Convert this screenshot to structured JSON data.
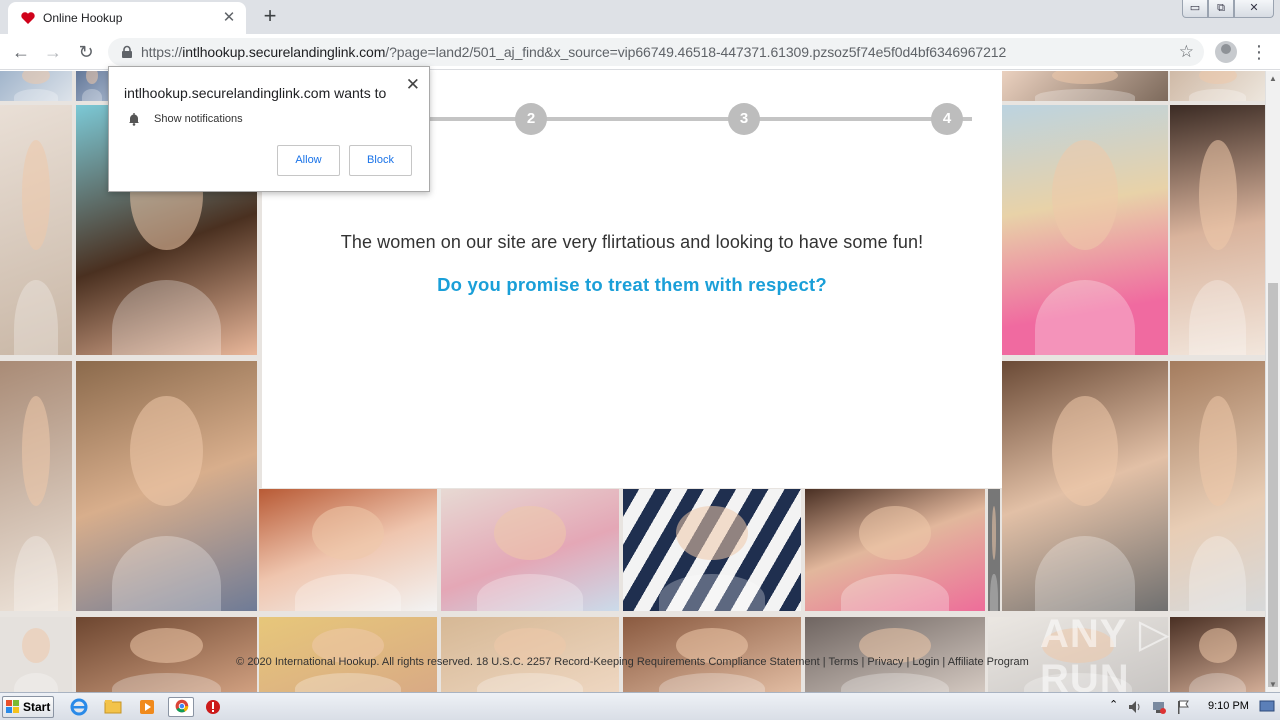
{
  "browser": {
    "tab_title": "Online Hookup",
    "tab_close": "✕",
    "new_tab": "+",
    "window_min": "▭",
    "window_max": "⧉",
    "window_close": "✕",
    "url_host": "intlhookup.securelandinglink.com",
    "url_scheme": "https://",
    "url_path": "/?page=land2/501_aj_find&x_source=vip66749.46518-447371.61309.pzsoz5f74e5f0d4bf6346967212",
    "back": "←",
    "forward": "→",
    "reload": "↻",
    "bookmark": "☆",
    "menu": "⋮"
  },
  "notification": {
    "title": "intlhookup.securelandinglink.com wants to",
    "close": "✕",
    "permission": "Show notifications",
    "allow": "Allow",
    "block": "Block"
  },
  "page": {
    "steps": [
      "2",
      "3",
      "4"
    ],
    "headline": "The women on our site are very flirtatious and looking to have some fun!",
    "question": "Do you promise to treat them with respect?",
    "footer": {
      "copyright": "© 2020 International Hookup. All rights reserved.",
      "compliance": "18 U.S.C. 2257 Record-Keeping Requirements Compliance Statement",
      "sep": "|",
      "terms": "Terms",
      "privacy": "Privacy",
      "login": "Login",
      "affiliate": "Affiliate Program"
    },
    "watermark": "ANY ▷ RUN"
  },
  "taskbar": {
    "start": "Start",
    "clock": "9:10 PM"
  },
  "colors": {
    "accent_blue": "#1a9fd8",
    "step_gray": "#bdbdbd"
  }
}
